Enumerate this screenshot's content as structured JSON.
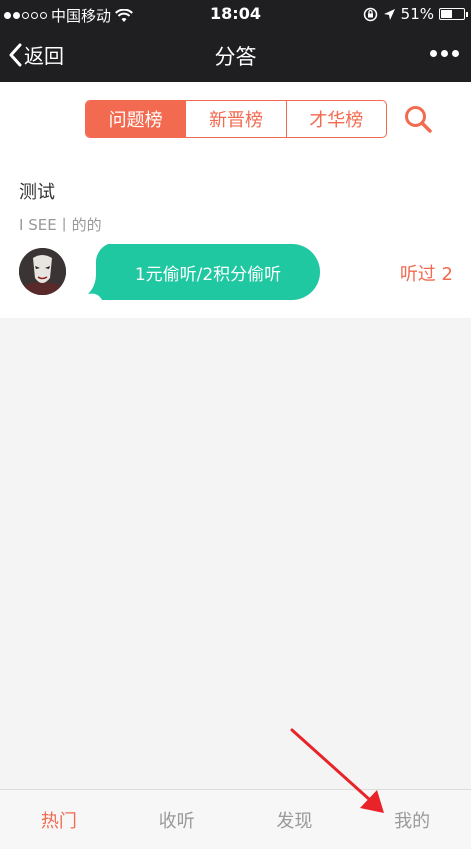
{
  "status_bar": {
    "carrier": "中国移动",
    "time": "18:04",
    "battery": "51%",
    "battery_level": 0.51
  },
  "nav": {
    "back_label": "返回",
    "title": "分答"
  },
  "tabs": [
    {
      "label": "问题榜",
      "active": true
    },
    {
      "label": "新晋榜",
      "active": false
    },
    {
      "label": "才华榜",
      "active": false
    }
  ],
  "question": {
    "title": "测试",
    "subtitle": "I SEE丨的的",
    "listen_button": "1元偷听/2积分偷听",
    "listen_count": "听过 2"
  },
  "bottom_tabs": [
    {
      "label": "热门",
      "active": true
    },
    {
      "label": "收听",
      "active": false
    },
    {
      "label": "发现",
      "active": false
    },
    {
      "label": "我的",
      "active": false
    }
  ],
  "colors": {
    "accent": "#f26a4f",
    "bubble": "#1fc8a1",
    "header": "#1f1f22",
    "annotation_arrow": "#e8242a"
  }
}
